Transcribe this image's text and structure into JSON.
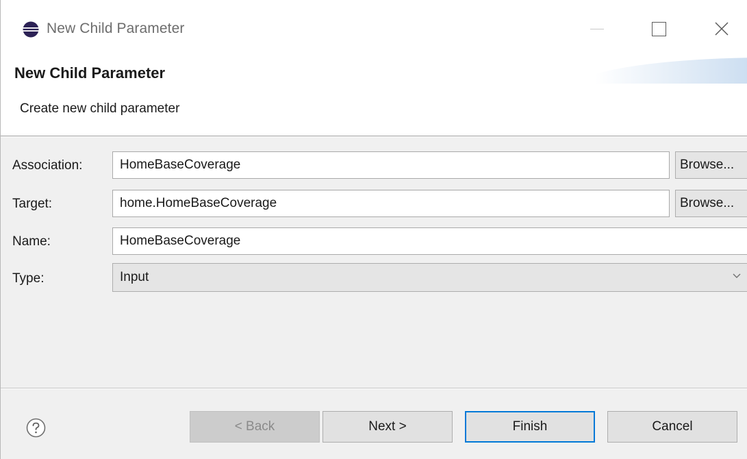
{
  "window": {
    "title": "New Child Parameter"
  },
  "banner": {
    "title": "New Child Parameter",
    "description": "Create new child parameter"
  },
  "form": {
    "association": {
      "label": "Association:",
      "value": "HomeBaseCoverage",
      "browse_label": "Browse..."
    },
    "target": {
      "label": "Target:",
      "value": "home.HomeBaseCoverage",
      "browse_label": "Browse..."
    },
    "name": {
      "label": "Name:",
      "value": "HomeBaseCoverage"
    },
    "type": {
      "label": "Type:",
      "selected": "Input"
    }
  },
  "buttons": {
    "back": "< Back",
    "next": "Next >",
    "finish": "Finish",
    "cancel": "Cancel"
  },
  "icons": {
    "app": "eclipse-icon",
    "help": "help-icon",
    "dropdown": "chevron-down-icon"
  },
  "colors": {
    "dialog_background": "#f0f0f0",
    "default_button_border": "#0078d7",
    "disabled_button_background": "#cccccc"
  }
}
